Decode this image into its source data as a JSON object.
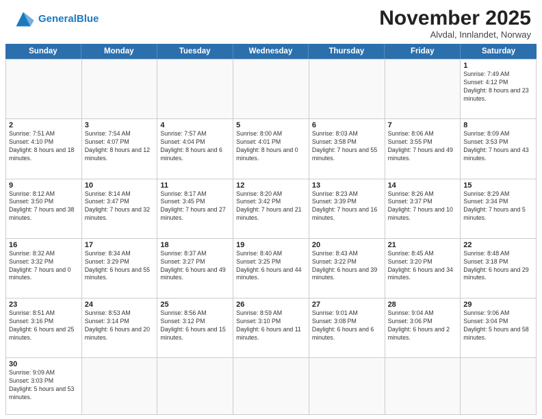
{
  "header": {
    "logo_general": "General",
    "logo_blue": "Blue",
    "month_title": "November 2025",
    "location": "Alvdal, Innlandet, Norway"
  },
  "days_of_week": [
    "Sunday",
    "Monday",
    "Tuesday",
    "Wednesday",
    "Thursday",
    "Friday",
    "Saturday"
  ],
  "cells": [
    {
      "day": "",
      "info": "",
      "empty": true
    },
    {
      "day": "",
      "info": "",
      "empty": true
    },
    {
      "day": "",
      "info": "",
      "empty": true
    },
    {
      "day": "",
      "info": "",
      "empty": true
    },
    {
      "day": "",
      "info": "",
      "empty": true
    },
    {
      "day": "",
      "info": "",
      "empty": true
    },
    {
      "day": "1",
      "info": "Sunrise: 7:49 AM\nSunset: 4:12 PM\nDaylight: 8 hours and 23 minutes.",
      "empty": false
    },
    {
      "day": "2",
      "info": "Sunrise: 7:51 AM\nSunset: 4:10 PM\nDaylight: 8 hours and 18 minutes.",
      "empty": false
    },
    {
      "day": "3",
      "info": "Sunrise: 7:54 AM\nSunset: 4:07 PM\nDaylight: 8 hours and 12 minutes.",
      "empty": false
    },
    {
      "day": "4",
      "info": "Sunrise: 7:57 AM\nSunset: 4:04 PM\nDaylight: 8 hours and 6 minutes.",
      "empty": false
    },
    {
      "day": "5",
      "info": "Sunrise: 8:00 AM\nSunset: 4:01 PM\nDaylight: 8 hours and 0 minutes.",
      "empty": false
    },
    {
      "day": "6",
      "info": "Sunrise: 8:03 AM\nSunset: 3:58 PM\nDaylight: 7 hours and 55 minutes.",
      "empty": false
    },
    {
      "day": "7",
      "info": "Sunrise: 8:06 AM\nSunset: 3:55 PM\nDaylight: 7 hours and 49 minutes.",
      "empty": false
    },
    {
      "day": "8",
      "info": "Sunrise: 8:09 AM\nSunset: 3:53 PM\nDaylight: 7 hours and 43 minutes.",
      "empty": false
    },
    {
      "day": "9",
      "info": "Sunrise: 8:12 AM\nSunset: 3:50 PM\nDaylight: 7 hours and 38 minutes.",
      "empty": false
    },
    {
      "day": "10",
      "info": "Sunrise: 8:14 AM\nSunset: 3:47 PM\nDaylight: 7 hours and 32 minutes.",
      "empty": false
    },
    {
      "day": "11",
      "info": "Sunrise: 8:17 AM\nSunset: 3:45 PM\nDaylight: 7 hours and 27 minutes.",
      "empty": false
    },
    {
      "day": "12",
      "info": "Sunrise: 8:20 AM\nSunset: 3:42 PM\nDaylight: 7 hours and 21 minutes.",
      "empty": false
    },
    {
      "day": "13",
      "info": "Sunrise: 8:23 AM\nSunset: 3:39 PM\nDaylight: 7 hours and 16 minutes.",
      "empty": false
    },
    {
      "day": "14",
      "info": "Sunrise: 8:26 AM\nSunset: 3:37 PM\nDaylight: 7 hours and 10 minutes.",
      "empty": false
    },
    {
      "day": "15",
      "info": "Sunrise: 8:29 AM\nSunset: 3:34 PM\nDaylight: 7 hours and 5 minutes.",
      "empty": false
    },
    {
      "day": "16",
      "info": "Sunrise: 8:32 AM\nSunset: 3:32 PM\nDaylight: 7 hours and 0 minutes.",
      "empty": false
    },
    {
      "day": "17",
      "info": "Sunrise: 8:34 AM\nSunset: 3:29 PM\nDaylight: 6 hours and 55 minutes.",
      "empty": false
    },
    {
      "day": "18",
      "info": "Sunrise: 8:37 AM\nSunset: 3:27 PM\nDaylight: 6 hours and 49 minutes.",
      "empty": false
    },
    {
      "day": "19",
      "info": "Sunrise: 8:40 AM\nSunset: 3:25 PM\nDaylight: 6 hours and 44 minutes.",
      "empty": false
    },
    {
      "day": "20",
      "info": "Sunrise: 8:43 AM\nSunset: 3:22 PM\nDaylight: 6 hours and 39 minutes.",
      "empty": false
    },
    {
      "day": "21",
      "info": "Sunrise: 8:45 AM\nSunset: 3:20 PM\nDaylight: 6 hours and 34 minutes.",
      "empty": false
    },
    {
      "day": "22",
      "info": "Sunrise: 8:48 AM\nSunset: 3:18 PM\nDaylight: 6 hours and 29 minutes.",
      "empty": false
    },
    {
      "day": "23",
      "info": "Sunrise: 8:51 AM\nSunset: 3:16 PM\nDaylight: 6 hours and 25 minutes.",
      "empty": false
    },
    {
      "day": "24",
      "info": "Sunrise: 8:53 AM\nSunset: 3:14 PM\nDaylight: 6 hours and 20 minutes.",
      "empty": false
    },
    {
      "day": "25",
      "info": "Sunrise: 8:56 AM\nSunset: 3:12 PM\nDaylight: 6 hours and 15 minutes.",
      "empty": false
    },
    {
      "day": "26",
      "info": "Sunrise: 8:59 AM\nSunset: 3:10 PM\nDaylight: 6 hours and 11 minutes.",
      "empty": false
    },
    {
      "day": "27",
      "info": "Sunrise: 9:01 AM\nSunset: 3:08 PM\nDaylight: 6 hours and 6 minutes.",
      "empty": false
    },
    {
      "day": "28",
      "info": "Sunrise: 9:04 AM\nSunset: 3:06 PM\nDaylight: 6 hours and 2 minutes.",
      "empty": false
    },
    {
      "day": "29",
      "info": "Sunrise: 9:06 AM\nSunset: 3:04 PM\nDaylight: 5 hours and 58 minutes.",
      "empty": false
    },
    {
      "day": "30",
      "info": "Sunrise: 9:09 AM\nSunset: 3:03 PM\nDaylight: 5 hours and 53 minutes.",
      "empty": false
    },
    {
      "day": "",
      "info": "",
      "empty": true
    },
    {
      "day": "",
      "info": "",
      "empty": true
    },
    {
      "day": "",
      "info": "",
      "empty": true
    },
    {
      "day": "",
      "info": "",
      "empty": true
    },
    {
      "day": "",
      "info": "",
      "empty": true
    },
    {
      "day": "",
      "info": "",
      "empty": true
    }
  ]
}
